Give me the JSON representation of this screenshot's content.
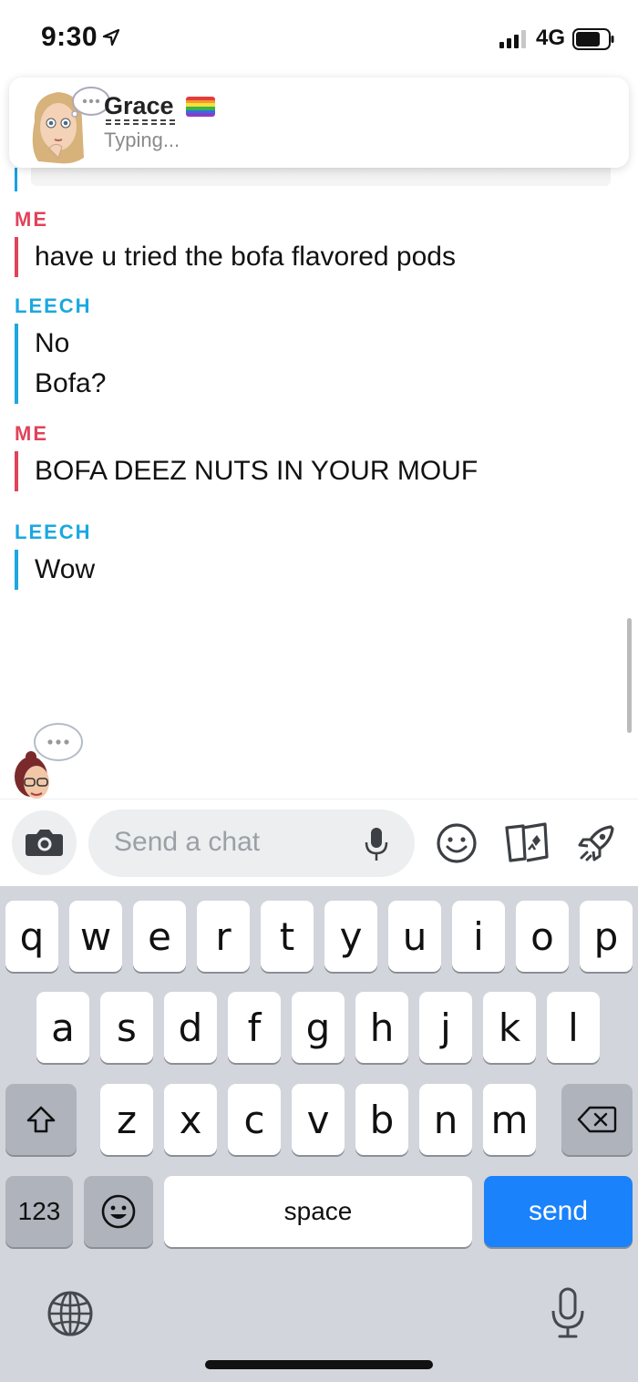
{
  "status_bar": {
    "time": "9:30",
    "network": "4G"
  },
  "chat_header": {
    "contact_name": "Grace",
    "contact_status": "Typing...",
    "flag": "rainbow-flag-icon"
  },
  "messages": [
    {
      "sender": "ME",
      "lines": [
        "have u tried the bofa flavored pods"
      ]
    },
    {
      "sender": "LEECH",
      "lines": [
        "No",
        "Bofa?"
      ]
    },
    {
      "sender": "ME",
      "lines": [
        "BOFA DEEZ NUTS IN YOUR MOUF"
      ]
    },
    {
      "sender": "LEECH",
      "lines": [
        "Wow"
      ]
    }
  ],
  "input_bar": {
    "placeholder": "Send a chat"
  },
  "keyboard": {
    "row1": [
      "q",
      "w",
      "e",
      "r",
      "t",
      "y",
      "u",
      "i",
      "o",
      "p"
    ],
    "row2": [
      "a",
      "s",
      "d",
      "f",
      "g",
      "h",
      "j",
      "k",
      "l"
    ],
    "row3": [
      "z",
      "x",
      "c",
      "v",
      "b",
      "n",
      "m"
    ],
    "numbers_key": "123",
    "space_key": "space",
    "send_key": "send"
  },
  "colors": {
    "me": "#e0435a",
    "leech": "#1ba8e0",
    "send_key": "#1a82fb"
  }
}
